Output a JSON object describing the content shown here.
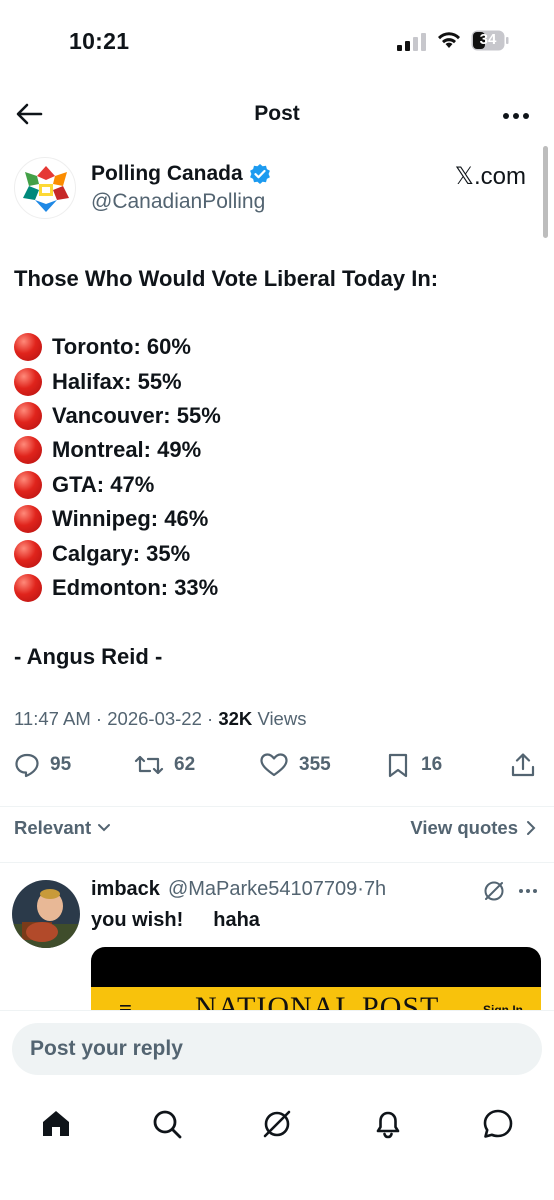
{
  "status_bar": {
    "time": "10:21",
    "battery": "34"
  },
  "header": {
    "title": "Post"
  },
  "author": {
    "name": "Polling Canada",
    "handle": "@CanadianPolling",
    "source": "𝕏.com"
  },
  "post": {
    "heading": "Those Who Would Vote Liberal Today In:",
    "lines": [
      "Toronto: 60%",
      "Halifax: 55%",
      "Vancouver: 55%",
      "Montreal: 49%",
      "GTA: 47%",
      "Winnipeg: 46%",
      "Calgary: 35%",
      "Edmonton: 33%"
    ],
    "source_note": "- Angus Reid -"
  },
  "meta": {
    "time": "11:47 AM",
    "date": "2026-03-22",
    "views_count": "32K",
    "views_label": "Views"
  },
  "actions": {
    "replies": "95",
    "reposts": "62",
    "likes": "355",
    "bookmarks": "16"
  },
  "filter": {
    "sort_label": "Relevant",
    "view_quotes": "View quotes"
  },
  "reply": {
    "name": "imback",
    "handle": "@MaParke54107709",
    "age": "7h",
    "text_1": "you wish!",
    "text_2": "haha",
    "image_text": "NATIONAL POST",
    "image_signin": "Sign In"
  },
  "composer": {
    "placeholder": "Post your reply"
  },
  "icons": {
    "header": [
      "back-arrow-icon",
      "more-icon"
    ],
    "actions": [
      "reply-icon",
      "repost-icon",
      "like-icon",
      "bookmark-icon",
      "share-icon"
    ],
    "nav": [
      "home-icon",
      "search-icon",
      "grok-icon",
      "notifications-icon",
      "messages-icon"
    ]
  },
  "colors": {
    "verified": "#1d9bf0",
    "bullet": "#e0241c",
    "muted": "#536471",
    "text": "#0f1419"
  }
}
